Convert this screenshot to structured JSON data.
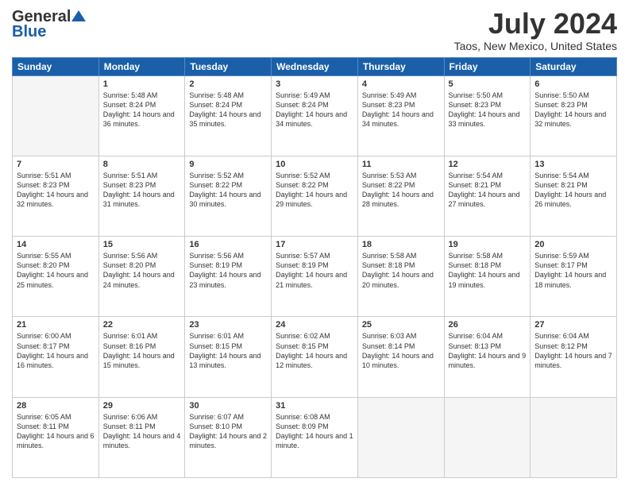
{
  "logo": {
    "general": "General",
    "blue": "Blue"
  },
  "title": "July 2024",
  "subtitle": "Taos, New Mexico, United States",
  "weekdays": [
    "Sunday",
    "Monday",
    "Tuesday",
    "Wednesday",
    "Thursday",
    "Friday",
    "Saturday"
  ],
  "weeks": [
    [
      {
        "day": "",
        "sunrise": "",
        "sunset": "",
        "daylight": ""
      },
      {
        "day": "1",
        "sunrise": "5:48 AM",
        "sunset": "8:24 PM",
        "daylight": "14 hours and 36 minutes."
      },
      {
        "day": "2",
        "sunrise": "5:48 AM",
        "sunset": "8:24 PM",
        "daylight": "14 hours and 35 minutes."
      },
      {
        "day": "3",
        "sunrise": "5:49 AM",
        "sunset": "8:24 PM",
        "daylight": "14 hours and 34 minutes."
      },
      {
        "day": "4",
        "sunrise": "5:49 AM",
        "sunset": "8:23 PM",
        "daylight": "14 hours and 34 minutes."
      },
      {
        "day": "5",
        "sunrise": "5:50 AM",
        "sunset": "8:23 PM",
        "daylight": "14 hours and 33 minutes."
      },
      {
        "day": "6",
        "sunrise": "5:50 AM",
        "sunset": "8:23 PM",
        "daylight": "14 hours and 32 minutes."
      }
    ],
    [
      {
        "day": "7",
        "sunrise": "5:51 AM",
        "sunset": "8:23 PM",
        "daylight": "14 hours and 32 minutes."
      },
      {
        "day": "8",
        "sunrise": "5:51 AM",
        "sunset": "8:23 PM",
        "daylight": "14 hours and 31 minutes."
      },
      {
        "day": "9",
        "sunrise": "5:52 AM",
        "sunset": "8:22 PM",
        "daylight": "14 hours and 30 minutes."
      },
      {
        "day": "10",
        "sunrise": "5:52 AM",
        "sunset": "8:22 PM",
        "daylight": "14 hours and 29 minutes."
      },
      {
        "day": "11",
        "sunrise": "5:53 AM",
        "sunset": "8:22 PM",
        "daylight": "14 hours and 28 minutes."
      },
      {
        "day": "12",
        "sunrise": "5:54 AM",
        "sunset": "8:21 PM",
        "daylight": "14 hours and 27 minutes."
      },
      {
        "day": "13",
        "sunrise": "5:54 AM",
        "sunset": "8:21 PM",
        "daylight": "14 hours and 26 minutes."
      }
    ],
    [
      {
        "day": "14",
        "sunrise": "5:55 AM",
        "sunset": "8:20 PM",
        "daylight": "14 hours and 25 minutes."
      },
      {
        "day": "15",
        "sunrise": "5:56 AM",
        "sunset": "8:20 PM",
        "daylight": "14 hours and 24 minutes."
      },
      {
        "day": "16",
        "sunrise": "5:56 AM",
        "sunset": "8:19 PM",
        "daylight": "14 hours and 23 minutes."
      },
      {
        "day": "17",
        "sunrise": "5:57 AM",
        "sunset": "8:19 PM",
        "daylight": "14 hours and 21 minutes."
      },
      {
        "day": "18",
        "sunrise": "5:58 AM",
        "sunset": "8:18 PM",
        "daylight": "14 hours and 20 minutes."
      },
      {
        "day": "19",
        "sunrise": "5:58 AM",
        "sunset": "8:18 PM",
        "daylight": "14 hours and 19 minutes."
      },
      {
        "day": "20",
        "sunrise": "5:59 AM",
        "sunset": "8:17 PM",
        "daylight": "14 hours and 18 minutes."
      }
    ],
    [
      {
        "day": "21",
        "sunrise": "6:00 AM",
        "sunset": "8:17 PM",
        "daylight": "14 hours and 16 minutes."
      },
      {
        "day": "22",
        "sunrise": "6:01 AM",
        "sunset": "8:16 PM",
        "daylight": "14 hours and 15 minutes."
      },
      {
        "day": "23",
        "sunrise": "6:01 AM",
        "sunset": "8:15 PM",
        "daylight": "14 hours and 13 minutes."
      },
      {
        "day": "24",
        "sunrise": "6:02 AM",
        "sunset": "8:15 PM",
        "daylight": "14 hours and 12 minutes."
      },
      {
        "day": "25",
        "sunrise": "6:03 AM",
        "sunset": "8:14 PM",
        "daylight": "14 hours and 10 minutes."
      },
      {
        "day": "26",
        "sunrise": "6:04 AM",
        "sunset": "8:13 PM",
        "daylight": "14 hours and 9 minutes."
      },
      {
        "day": "27",
        "sunrise": "6:04 AM",
        "sunset": "8:12 PM",
        "daylight": "14 hours and 7 minutes."
      }
    ],
    [
      {
        "day": "28",
        "sunrise": "6:05 AM",
        "sunset": "8:11 PM",
        "daylight": "14 hours and 6 minutes."
      },
      {
        "day": "29",
        "sunrise": "6:06 AM",
        "sunset": "8:11 PM",
        "daylight": "14 hours and 4 minutes."
      },
      {
        "day": "30",
        "sunrise": "6:07 AM",
        "sunset": "8:10 PM",
        "daylight": "14 hours and 2 minutes."
      },
      {
        "day": "31",
        "sunrise": "6:08 AM",
        "sunset": "8:09 PM",
        "daylight": "14 hours and 1 minute."
      },
      {
        "day": "",
        "sunrise": "",
        "sunset": "",
        "daylight": ""
      },
      {
        "day": "",
        "sunrise": "",
        "sunset": "",
        "daylight": ""
      },
      {
        "day": "",
        "sunrise": "",
        "sunset": "",
        "daylight": ""
      }
    ]
  ]
}
